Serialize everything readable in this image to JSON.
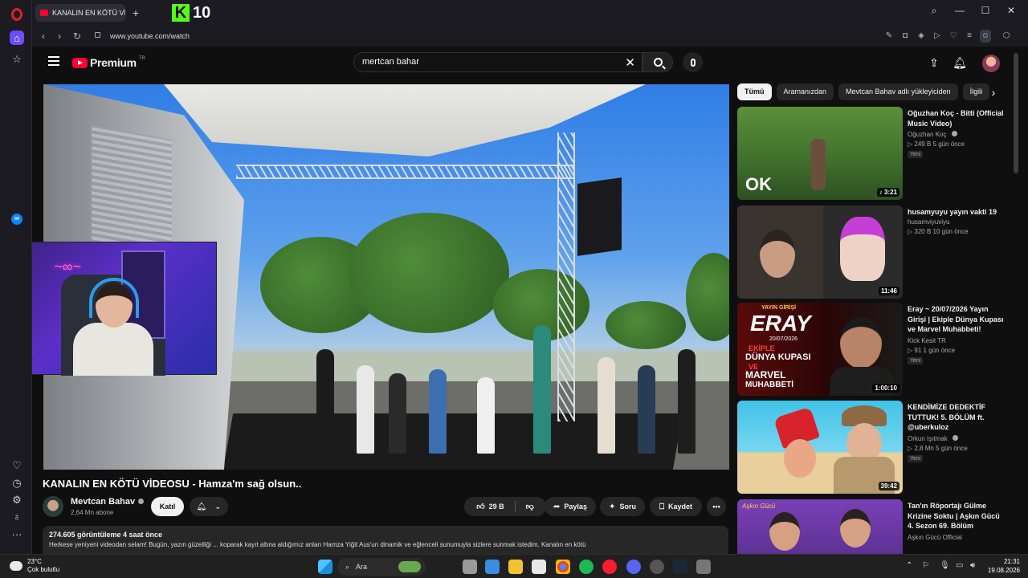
{
  "browser": {
    "tab_title": "KANALIN EN KÖTÜ VİDEO",
    "url": "www.youtube.com/watch",
    "kick_badge": "10",
    "kick_letter": "K"
  },
  "youtube": {
    "logo_text": "Premium",
    "logo_region": "TR",
    "search_query": "mertcan bahar"
  },
  "video": {
    "title": "KANALIN EN KÖTÜ VİDEOSU - Hamza'm sağ olsun..",
    "channel_name": "Mevtcan Bahav",
    "subscribers": "2,64 Mn abone",
    "join_label": "Katıl",
    "likes": "29 B",
    "share_label": "Paylaş",
    "ask_label": "Soru",
    "save_label": "Kaydet",
    "views_time": "274.605 görüntüleme  4 saat önce",
    "description": "Herkese yeniyeni videodan selam! Bugün, yazın güzelliği ... koparak kayıt altına aldığımız anları Hamza Yiğit Aus'un dinamik ve eğlenceli sunumuyla sizlere sunmak istedim. Kanalın en kötü"
  },
  "chips": [
    "Tümü",
    "Aramanızdan",
    "Mevtcan Bahav adlı yükleyiciden",
    "İlgili"
  ],
  "recommendations": [
    {
      "title": "Oğuzhan Koç - Bitti (Official Music Video)",
      "channel": "Oğuzhan Koç",
      "verified": true,
      "views": "249 B",
      "age": "5 gün önce",
      "badge": "Yeni",
      "duration": "3:21",
      "music": true
    },
    {
      "title": "husamyuyu yayın vakti 19",
      "channel": "husamviyuviyu",
      "verified": false,
      "views": "320 B",
      "age": "10 gün önce",
      "badge": "",
      "duration": "11:46",
      "music": false
    },
    {
      "title": "Eray ~ 20/07/2026 Yayın Girişi | Ekiple Dünya Kupası ve Marvel Muhabbeti!",
      "channel": "Kick Kesit TR",
      "verified": false,
      "views": "91",
      "age": "1 gün önce",
      "badge": "Yeni",
      "duration": "1:00:10",
      "music": false
    },
    {
      "title": "KENDİMİZE DEDEKTİF TUTTUK! 5. BÖLÜM ft. @uberkuloz",
      "channel": "Orkun Işıtmak",
      "verified": true,
      "views": "2,8 Mn",
      "age": "5 gün önce",
      "badge": "Yeni",
      "duration": "39:42",
      "music": false
    },
    {
      "title": "Tan'ın Röportajı Gülme Krizine Soktu | Aşkın Gücü 4. Sezon 69. Bölüm",
      "channel": "Aşkın Gücü Official",
      "verified": false,
      "views": "",
      "age": "",
      "badge": "",
      "duration": "",
      "music": false
    }
  ],
  "thumb_text": {
    "eray_top": "YAYIN GİRİŞİ",
    "eray_name": "ERAY",
    "eray_date": "20/07/2026",
    "eray_lines": [
      "EKİPLE",
      "DÜNYA KUPASI",
      "VE",
      "MARVEL",
      "MUHABBETİ"
    ],
    "ok_logo": "OK",
    "askin": "Aşkın Gücü"
  },
  "taskbar": {
    "temp": "23°C",
    "weather": "Çok bulutlu",
    "search_label": "Ara",
    "time": "21:31",
    "date": "19.08.2026"
  }
}
